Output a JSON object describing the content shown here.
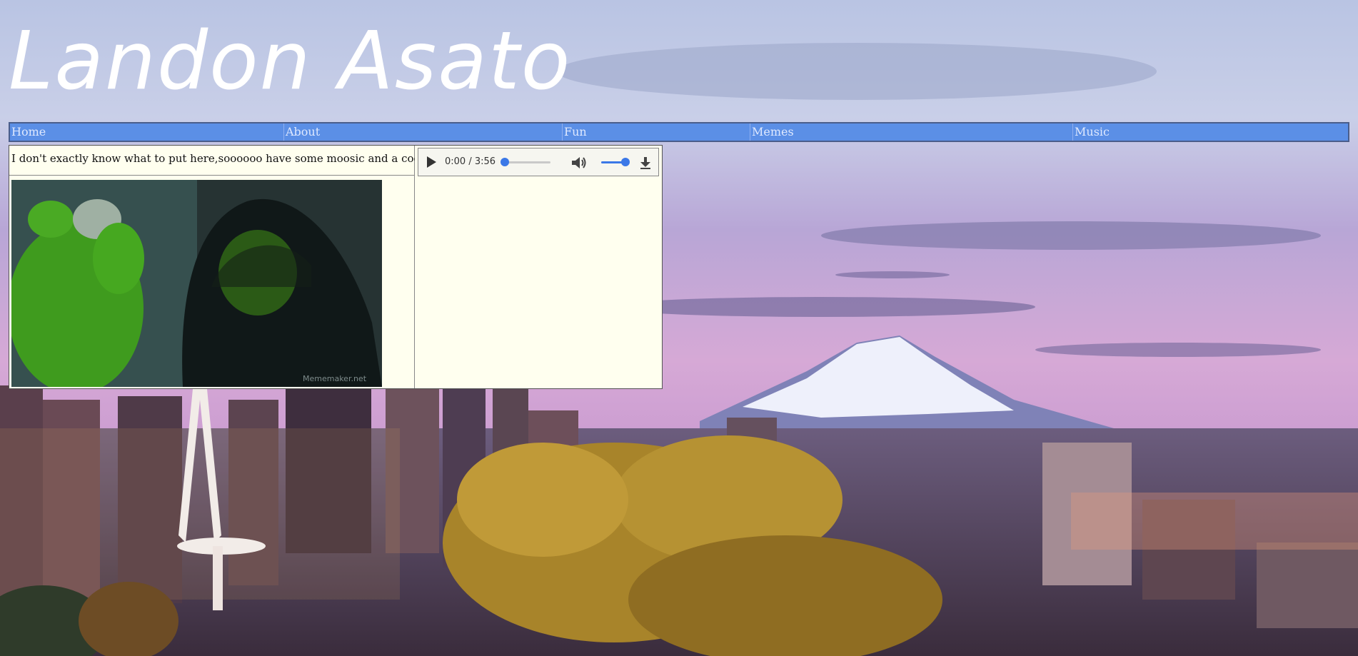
{
  "header": {
    "title": "Landon Asato"
  },
  "nav": {
    "items": [
      {
        "label": "Home"
      },
      {
        "label": "About"
      },
      {
        "label": "Fun"
      },
      {
        "label": "Memes"
      },
      {
        "label": "Music"
      }
    ]
  },
  "content": {
    "caption": "I don't exactly know what to put here,soooooo have some moosic and a cooky",
    "meme_watermark": "Mememaker.net"
  },
  "audio_player": {
    "time": "0:00 / 3:56",
    "progress_fraction": 0.0,
    "volume_fraction": 1.0,
    "icons": {
      "play": "play-icon",
      "volume": "volume-icon",
      "download": "download-icon"
    },
    "accent_color": "#3b78e7"
  },
  "colors": {
    "nav_background": "#5b8fe6",
    "content_background": "#ffffef",
    "title_color": "#ffffff"
  }
}
